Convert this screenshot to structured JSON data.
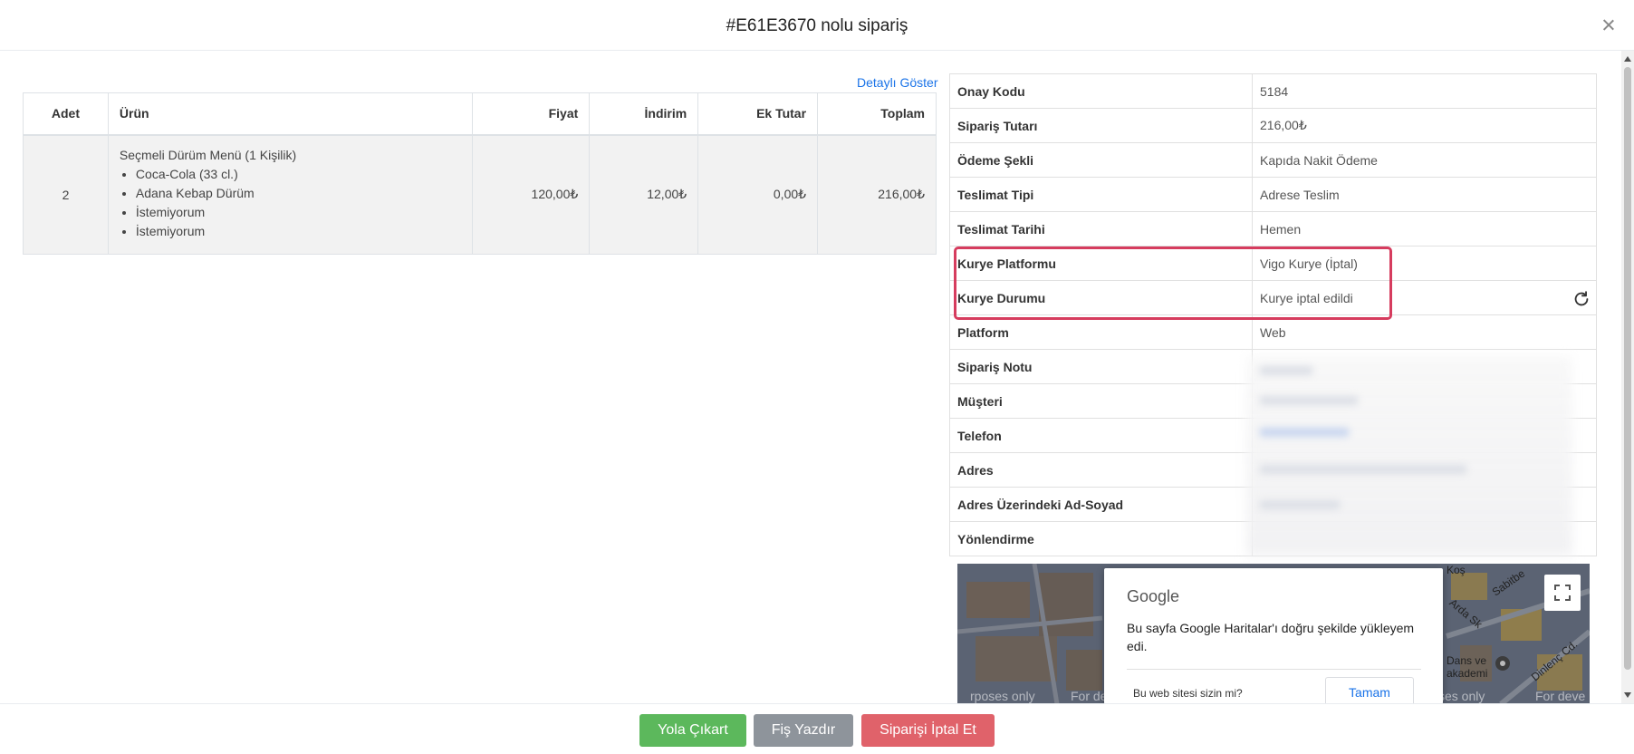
{
  "header": {
    "title": "#E61E3670 nolu sipariş"
  },
  "detail_link": "Detaylı Göster",
  "items_table": {
    "headers": {
      "adet": "Adet",
      "urun": "Ürün",
      "fiyat": "Fiyat",
      "indirim": "İndirim",
      "ek_tutar": "Ek Tutar",
      "toplam": "Toplam"
    },
    "rows": [
      {
        "adet": "2",
        "urun": "Seçmeli Dürüm Menü (1 Kişilik)",
        "options": [
          "Coca-Cola (33 cl.)",
          "Adana Kebap Dürüm",
          "İstemiyorum",
          "İstemiyorum"
        ],
        "fiyat": "120,00₺",
        "indirim": "12,00₺",
        "ek_tutar": "0,00₺",
        "toplam": "216,00₺"
      }
    ]
  },
  "order_info": [
    {
      "label": "Onay Kodu",
      "value": "5184"
    },
    {
      "label": "Sipariş Tutarı",
      "value": "216,00₺"
    },
    {
      "label": "Ödeme Şekli",
      "value": "Kapıda Nakit Ödeme"
    },
    {
      "label": "Teslimat Tipi",
      "value": "Adrese Teslim"
    },
    {
      "label": "Teslimat Tarihi",
      "value": "Hemen"
    },
    {
      "label": "Kurye Platformu",
      "value": "Vigo Kurye (İptal)"
    },
    {
      "label": "Kurye Durumu",
      "value": "Kurye iptal edildi"
    },
    {
      "label": "Platform",
      "value": "Web"
    },
    {
      "label": "Sipariş Notu",
      "value": ""
    },
    {
      "label": "Müşteri",
      "value": ""
    },
    {
      "label": "Telefon",
      "value": ""
    },
    {
      "label": "Adres",
      "value": ""
    },
    {
      "label": "Adres Üzerindeki Ad-Soyad",
      "value": ""
    },
    {
      "label": "Yönlendirme",
      "value": ""
    }
  ],
  "map": {
    "google_label": "Google",
    "message": "Bu sayfa Google Haritalar'ı doğru şekilde yükleyem edi.",
    "owner_question": "Bu web sitesi sizin mi?",
    "ok_label": "Tamam",
    "dev_text_left": "rposes only",
    "dev_text_left2": "For de",
    "dev_text_right": "ses only",
    "dev_text_right2": "For deve",
    "street_labels": [
      "Koş",
      "Sabitbe",
      "Arda Sk",
      "Dans ve",
      "akademi",
      "Dinlenç Cd."
    ]
  },
  "footer": {
    "ship_label": "Yola Çıkart",
    "print_label": "Fiş Yazdır",
    "cancel_label": "Siparişi İptal Et"
  },
  "colors": {
    "green": "#5cb85c",
    "gray": "#8e949b",
    "red": "#e0626a",
    "highlight": "#d63c5e",
    "link": "#1a73e8"
  }
}
